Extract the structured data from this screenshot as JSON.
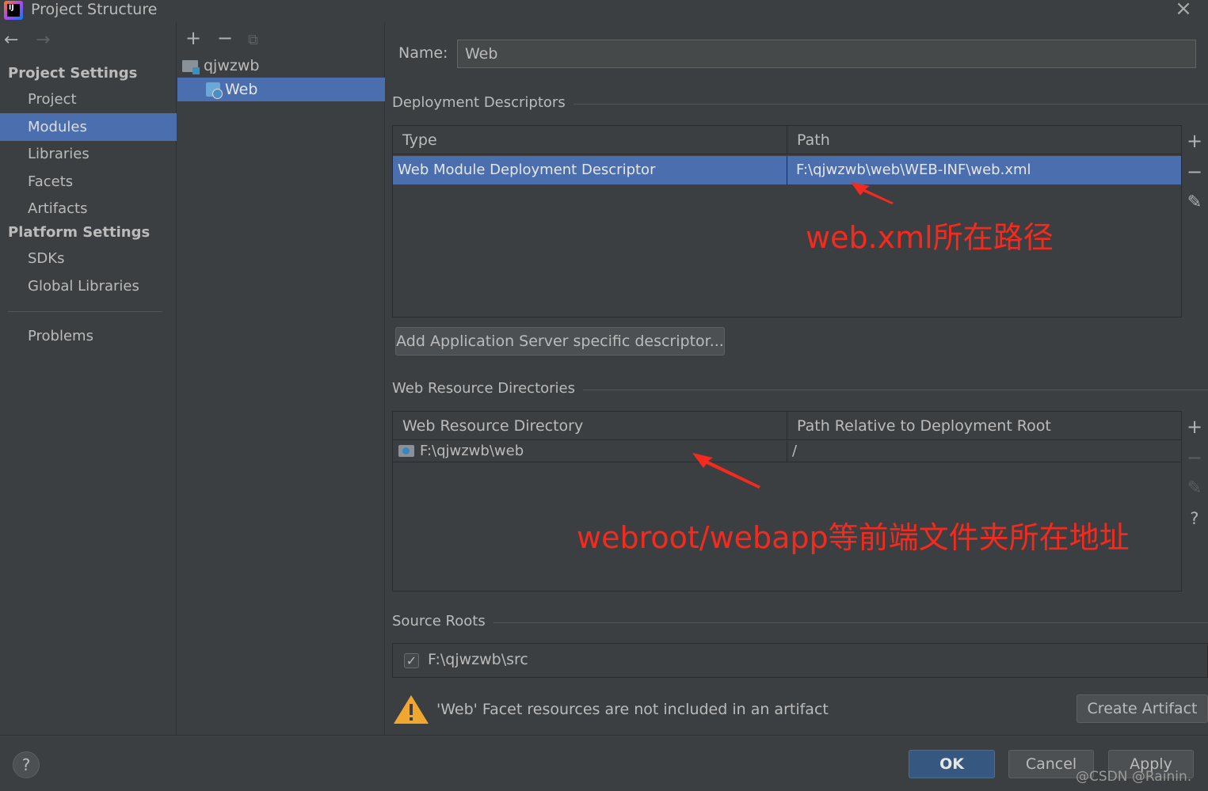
{
  "window": {
    "title": "Project Structure",
    "close": "×",
    "logo_text": "IJ"
  },
  "nav": {
    "back": "←",
    "forward": "→"
  },
  "sidebar": {
    "project_settings_heading": "Project Settings",
    "project_items": [
      "Project",
      "Modules",
      "Libraries",
      "Facets",
      "Artifacts"
    ],
    "platform_settings_heading": "Platform Settings",
    "platform_items": [
      "SDKs",
      "Global Libraries"
    ],
    "problems": "Problems",
    "selected": "Modules"
  },
  "tree": {
    "tools": {
      "add": "+",
      "remove": "−",
      "copy": "⧉"
    },
    "nodes": [
      {
        "label": "qjwzwb",
        "kind": "module-folder"
      },
      {
        "label": "Web",
        "kind": "web-facet",
        "selected": true
      }
    ]
  },
  "main": {
    "name_label": "Name:",
    "name_value": "Web",
    "deployment_descriptors": {
      "title": "Deployment Descriptors",
      "columns": [
        "Type",
        "Path"
      ],
      "rows": [
        {
          "type": "Web Module Deployment Descriptor",
          "path": "F:\\qjwzwb\\web\\WEB-INF\\web.xml",
          "selected": true
        }
      ],
      "tools": {
        "add": "+",
        "remove": "−",
        "edit": "✎"
      },
      "annotation": "web.xml所在路径"
    },
    "add_descriptor_button": "Add Application Server specific descriptor...",
    "web_resource_directories": {
      "title": "Web Resource Directories",
      "columns": [
        "Web Resource Directory",
        "Path Relative to Deployment Root"
      ],
      "rows": [
        {
          "directory": "F:\\qjwzwb\\web",
          "relative_path": "/"
        }
      ],
      "tools": {
        "add": "+",
        "remove": "−",
        "edit": "✎",
        "help": "?"
      },
      "annotation": "webroot/webapp等前端文件夹所在地址"
    },
    "source_roots": {
      "title": "Source Roots",
      "items": [
        {
          "path": "F:\\qjwzwb\\src",
          "checked": true
        }
      ]
    },
    "warning": {
      "text": "'Web' Facet resources are not included in an artifact",
      "button": "Create Artifact"
    }
  },
  "footer": {
    "help": "?",
    "ok": "OK",
    "cancel": "Cancel",
    "apply": "Apply"
  },
  "watermark": "@CSDN @Rainin.",
  "colors": {
    "selection": "#4b6eaf",
    "annotation": "#f52a1e",
    "background": "#3c3f41"
  }
}
